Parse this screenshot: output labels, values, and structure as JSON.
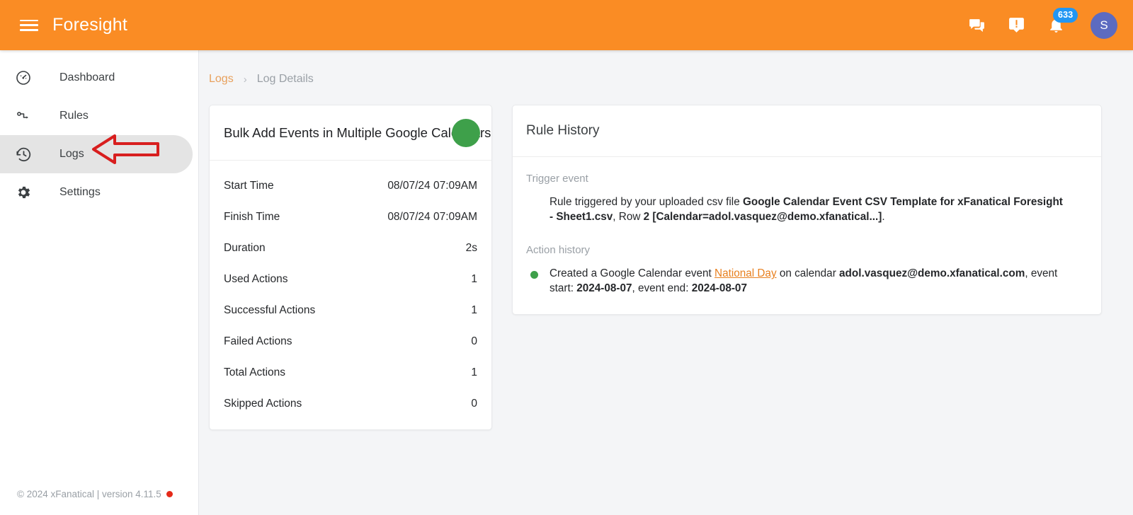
{
  "topbar": {
    "brand": "Foresight",
    "menu_icon": "hamburger-menu-icon",
    "chat_icon": "chat-bubble-icon",
    "feedback_icon": "feedback-alert-icon",
    "notifications_icon": "bell-icon",
    "notifications_count": "633",
    "avatar_initial": "S",
    "background_color": "#fa8c24",
    "badge_color": "#2196f3",
    "avatar_color": "#5c6bc0"
  },
  "sidebar": {
    "items": [
      {
        "label": "Dashboard",
        "icon": "speedometer-icon",
        "active": false
      },
      {
        "label": "Rules",
        "icon": "rule-flow-icon",
        "active": false
      },
      {
        "label": "Logs",
        "icon": "history-clock-icon",
        "active": true
      },
      {
        "label": "Settings",
        "icon": "gear-icon",
        "active": false
      }
    ],
    "footer": {
      "text": "© 2024 xFanatical | version 4.11.5",
      "dot_color": "#e52a19"
    }
  },
  "annotation": {
    "type": "left-arrow",
    "color": "#d81e1e",
    "points_to": "sidebar-item-logs"
  },
  "breadcrumb": {
    "link": "Logs",
    "separator": "›",
    "current": "Log Details",
    "link_color": "#e8a05c"
  },
  "summary": {
    "title": "Bulk Add Events in Multiple Google Calendars",
    "status_color": "#3ea04a",
    "status_name": "success-status-indicator",
    "rows": [
      {
        "label": "Start Time",
        "value": "08/07/24 07:09AM"
      },
      {
        "label": "Finish Time",
        "value": "08/07/24 07:09AM"
      },
      {
        "label": "Duration",
        "value": "2s"
      },
      {
        "label": "Used Actions",
        "value": "1"
      },
      {
        "label": "Successful Actions",
        "value": "1"
      },
      {
        "label": "Failed Actions",
        "value": "0"
      },
      {
        "label": "Total Actions",
        "value": "1"
      },
      {
        "label": "Skipped Actions",
        "value": "0"
      }
    ]
  },
  "history": {
    "title": "Rule History",
    "trigger_label": "Trigger event",
    "trigger": {
      "prefix": "Rule triggered by your uploaded csv file ",
      "file": "Google Calendar Event CSV Template for xFanatical Foresight - Sheet1.csv",
      "middle": ", Row ",
      "row": "2 [Calendar=adol.vasquez@demo.xfanatical...]",
      "suffix": "."
    },
    "action_label": "Action history",
    "actions": [
      {
        "dot_color": "#3ea04a",
        "prefix": "Created a Google Calendar event ",
        "event_link": "National Day",
        "middle": " on calendar ",
        "calendar": "adol.vasquez@demo.xfanatical.com",
        "start_label": ", event start: ",
        "start_date": "2024-08-07",
        "end_label": ", event end: ",
        "end_date": "2024-08-07"
      }
    ]
  }
}
